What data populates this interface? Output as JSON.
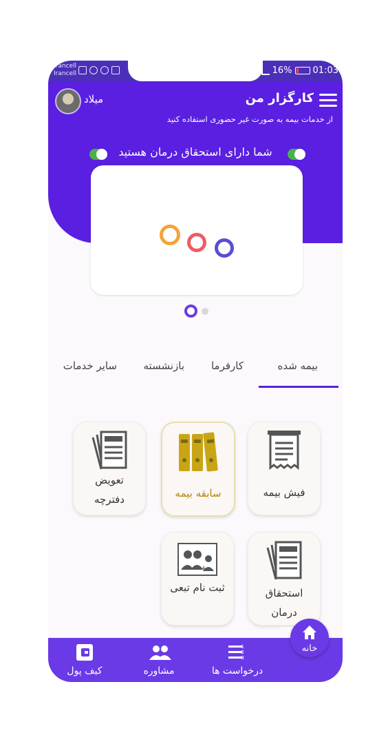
{
  "status_bar": {
    "carrier_lines": [
      "Irancell",
      "Irancell"
    ],
    "battery": "16%",
    "time": "01:03"
  },
  "header": {
    "app_title": "کارگزار من",
    "subtitle": "از خدمات بیمه به صورت غیر حضوری استفاده کنید",
    "username": "میلاد",
    "eligibility_text": "شما دارای استحقاق درمان هستید"
  },
  "tabs": [
    {
      "label": "بیمه شده",
      "active": true
    },
    {
      "label": "کارفرما",
      "active": false
    },
    {
      "label": "بازنشسته",
      "active": false
    },
    {
      "label": "سایر خدمات",
      "active": false
    }
  ],
  "tiles": [
    {
      "label": "فیش بیمه",
      "icon": "receipt-icon"
    },
    {
      "label": "سابقه بیمه",
      "icon": "binders-icon"
    },
    {
      "label": "تعویض دفترچه",
      "icon": "documents-icon"
    },
    {
      "label": "استحقاق درمان",
      "icon": "documents-icon"
    },
    {
      "label": "ثبت نام تبعی",
      "icon": "family-register-icon"
    }
  ],
  "bottom_nav": [
    {
      "label": "کیف پول",
      "icon": "wallet-icon"
    },
    {
      "label": "مشاوره",
      "icon": "people-icon"
    },
    {
      "label": "درخواست ها",
      "icon": "numbered-list-icon"
    },
    {
      "label": "خانه",
      "icon": "home-icon"
    }
  ],
  "colors": {
    "primary": "#5a1fe0",
    "accent": "#6a3ae6",
    "selected_tile_text": "#b8860b",
    "toggle": "#4caf50"
  }
}
